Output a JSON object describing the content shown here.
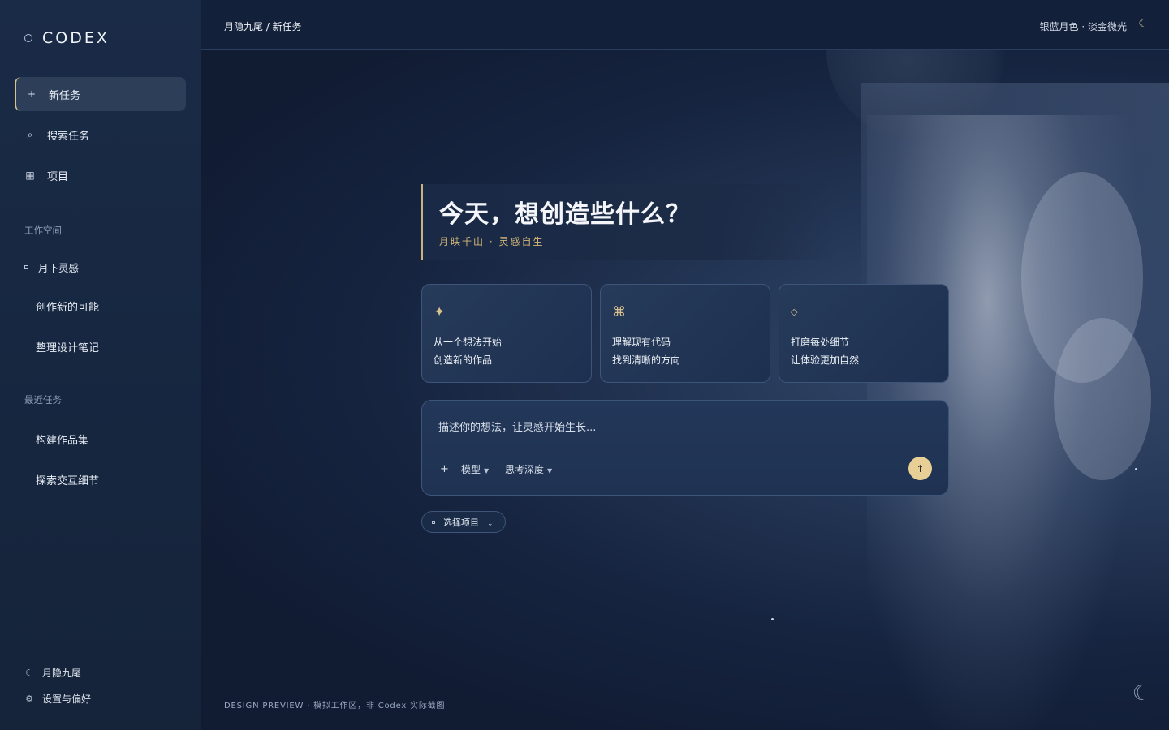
{
  "app": {
    "logo_text": "CODEX"
  },
  "sidebar": {
    "nav": [
      {
        "icon": "+",
        "label": "新任务"
      },
      {
        "icon": "⌕",
        "label": "搜索任务"
      },
      {
        "icon": "▦",
        "label": "项目"
      }
    ],
    "workspace_label": "工作空间",
    "workspace_name": "月下灵感",
    "workspace_items": [
      "创作新的可能",
      "整理设计笔记"
    ],
    "recent_label": "最近任务",
    "recent_items": [
      "构建作品集",
      "探索交互细节"
    ],
    "bottom": [
      {
        "icon": "☾",
        "label": "月隐九尾"
      },
      {
        "icon": "⚙",
        "label": "设置与偏好"
      }
    ]
  },
  "header": {
    "breadcrumb": "月隐九尾 / 新任务",
    "theme_label": "银蓝月色 · 淡金微光",
    "theme_icon": "☾"
  },
  "hero": {
    "title": "今天，想创造些什么？",
    "subtitle": "月映千山 · 灵感自生"
  },
  "cards": [
    {
      "icon": "✦",
      "line1": "从一个想法开始",
      "line2": "创造新的作品"
    },
    {
      "icon": "⌘",
      "line1": "理解现有代码",
      "line2": "找到清晰的方向"
    },
    {
      "icon": "◇",
      "line1": "打磨每处细节",
      "line2": "让体验更加自然"
    }
  ],
  "composer": {
    "placeholder": "描述你的想法，让灵感开始生长...",
    "plus": "+",
    "model_label": "模型",
    "depth_label": "思考深度",
    "send_icon": "↑"
  },
  "project_selector": {
    "label": "选择项目",
    "chevron": "⌄"
  },
  "footer": {
    "note": "DESIGN PREVIEW · 模拟工作区，非 Codex 实际截图"
  },
  "colors": {
    "accent_gold": "#d9c28f",
    "bg": "#0f1a2e",
    "sidebar": "#1a2b47"
  }
}
